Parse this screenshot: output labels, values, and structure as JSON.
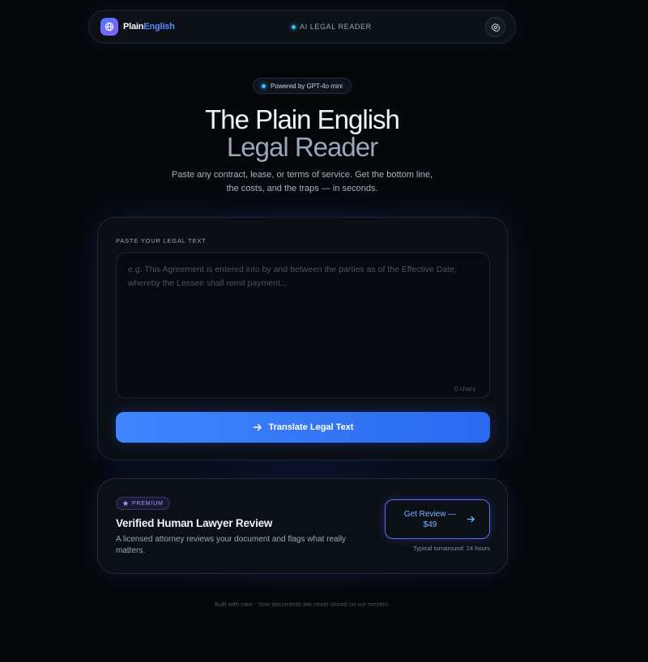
{
  "nav": {
    "brand_part1": "Plain",
    "brand_part2": "English",
    "center_label": "AI LEGAL READER"
  },
  "hero": {
    "powered_by": "Powered by GPT-4o mini",
    "title_line1": "The Plain English",
    "title_line2": "Legal Reader",
    "subtitle": "Paste any contract, lease, or terms of service. Get the bottom line, the costs, and the traps — in seconds."
  },
  "input_card": {
    "label": "PASTE YOUR LEGAL TEXT",
    "placeholder": "e.g. This Agreement is entered into by and between the parties as of the Effective Date, whereby the Lessee shall remit payment...",
    "value": "",
    "char_count": "0 chars",
    "translate_label": "Translate Legal Text"
  },
  "premium": {
    "badge": "PREMIUM",
    "title": "Verified Human Lawyer Review",
    "description": "A licensed attorney reviews your document and flags what really matters.",
    "button_label": "Get Review — $49",
    "turnaround": "Typical turnaround: 24 hours"
  },
  "footer": {
    "text": "Built with care · Your documents are never stored on our servers."
  },
  "icons": {
    "brand": "globe-icon",
    "settings": "gear-icon",
    "translate": "arrow-right-icon",
    "badge": "star-icon",
    "review": "arrow-right-icon"
  },
  "colors": {
    "accent": "#3f86ff",
    "brand_secondary": "#5b8cff",
    "premium_accent": "#a79cf0",
    "status_dot": "#38bdf8",
    "background": "#05070b"
  }
}
